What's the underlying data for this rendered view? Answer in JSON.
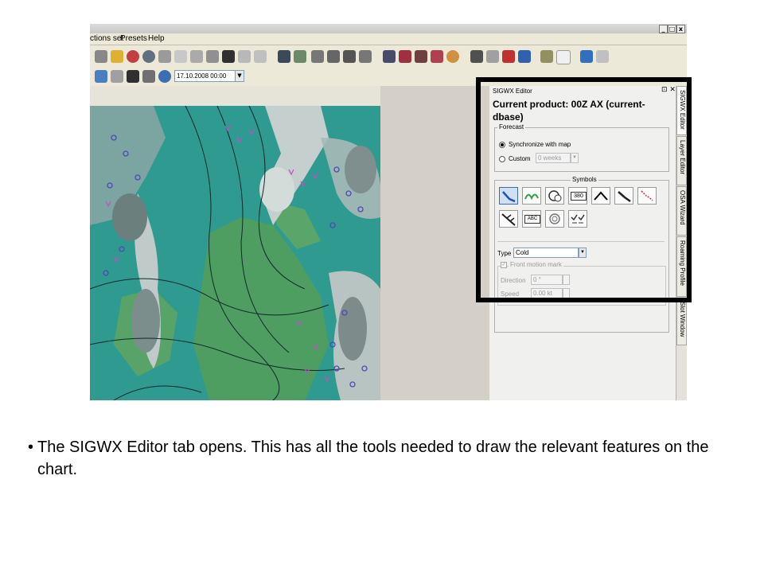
{
  "menu": {
    "items": [
      "ctions set",
      "Presets",
      "Help"
    ]
  },
  "window_buttons": [
    "_",
    "□",
    "x"
  ],
  "toolbar2": {
    "datetime": "17.10.2008 00:00"
  },
  "panel": {
    "title": "SIGWX Editor",
    "controls": "⊡ ✕",
    "current_product": "Current product: 00Z AX (current-dbase)",
    "forecast": {
      "legend": "Forecast",
      "sync_label": "Synchronize with map",
      "custom_label": "Custom",
      "custom_value": "0 weeks"
    },
    "symbols_legend": "Symbols",
    "symbol_texts": {
      "fl": "380",
      "abc": "ABC"
    },
    "type_label": "Type",
    "type_value": "Cold",
    "front_motion_label": "Front motion mark",
    "direction_label": "Direction",
    "direction_value": "0 °",
    "speed_label": "Speed",
    "speed_value": "0.00 kt"
  },
  "side_tabs": [
    "SIGWX Editor",
    "Layer Editor",
    "OSA Wizard",
    "Roaming Profile",
    "Slot Window"
  ],
  "caption": {
    "bullet": "•",
    "text": "The SIGWX Editor tab opens. This has all the tools needed to draw the relevant features on the chart."
  },
  "colors": {
    "highlight": "#000000",
    "map_sea": "#2f9a8f",
    "map_land": "#4e9e62",
    "map_cloud": "#b9c6c4"
  }
}
